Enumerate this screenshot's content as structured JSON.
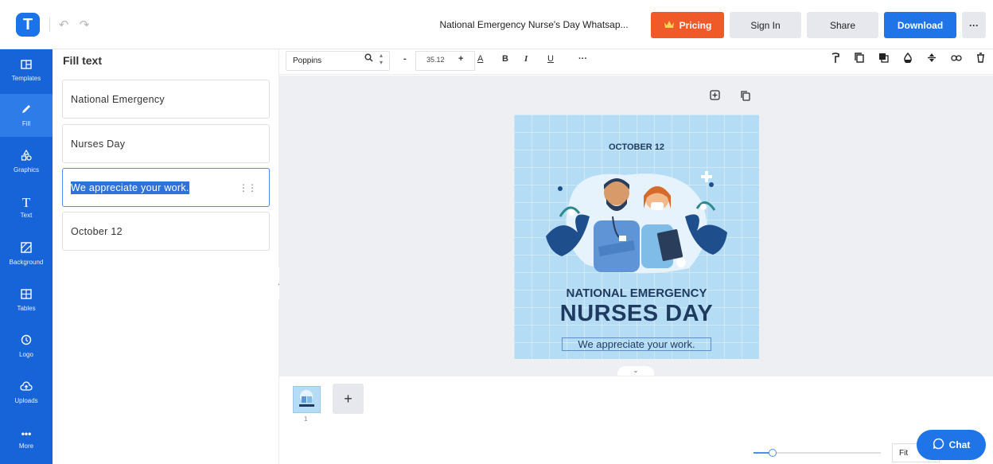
{
  "header": {
    "logo_letter": "T",
    "doc_title": "National Emergency Nurse's Day Whatsap...",
    "pricing_label": "Pricing",
    "signin_label": "Sign In",
    "share_label": "Share",
    "download_label": "Download",
    "more_label": "···"
  },
  "nav": {
    "items": [
      {
        "label": "Templates",
        "icon": "templates-icon"
      },
      {
        "label": "Fill",
        "icon": "pencil-icon"
      },
      {
        "label": "Graphics",
        "icon": "shapes-icon"
      },
      {
        "label": "Text",
        "icon": "text-icon"
      },
      {
        "label": "Background",
        "icon": "background-icon"
      },
      {
        "label": "Tables",
        "icon": "table-icon"
      },
      {
        "label": "Logo",
        "icon": "logo-icon"
      },
      {
        "label": "Uploads",
        "icon": "cloud-upload-icon"
      },
      {
        "label": "More",
        "icon": "more-icon"
      }
    ]
  },
  "panel": {
    "title": "Fill text",
    "fields": [
      {
        "value": "National Emergency"
      },
      {
        "value": "Nurses Day"
      },
      {
        "value": "We appreciate your work."
      },
      {
        "value": "October 12"
      }
    ]
  },
  "toolbar": {
    "font": "Poppins",
    "font_size": "35.12",
    "minus": "-",
    "plus": "+",
    "more": "···"
  },
  "design": {
    "date": "OCTOBER 12",
    "title_line1": "NATIONAL EMERGENCY",
    "title_line2": "NURSES DAY",
    "tagline": "We appreciate your work.",
    "background_color": "#b4dcf5",
    "text_color": "#1f3a5f"
  },
  "pages": {
    "page_number": "1",
    "add_label": "+",
    "zoom_label": "Fit",
    "zoom_fraction": 0.15
  },
  "chat": {
    "label": "Chat"
  },
  "colors": {
    "brand_blue": "#1f74e8",
    "pricing_orange": "#f05a28",
    "nav_blue": "#1664d8"
  }
}
